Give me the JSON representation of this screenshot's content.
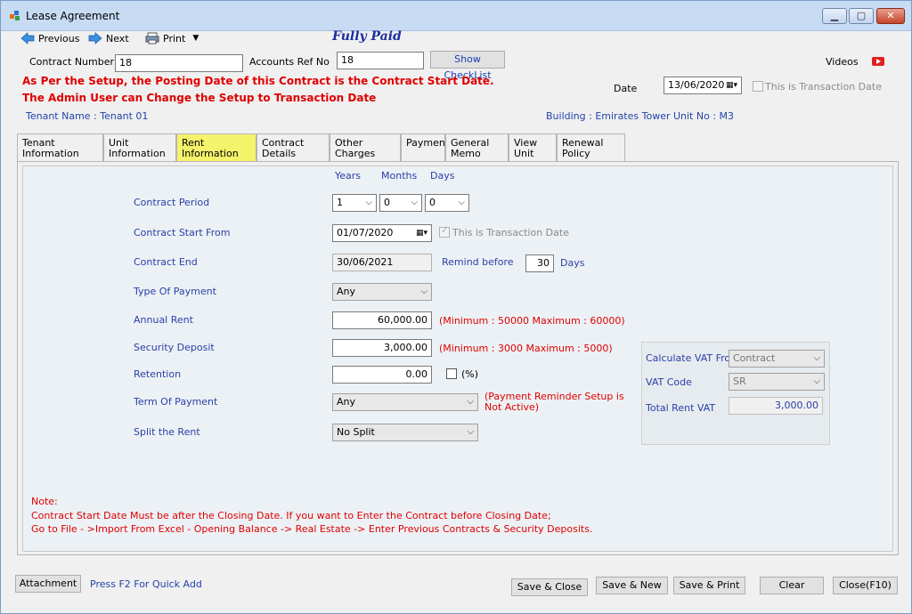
{
  "window": {
    "title": "Lease Agreement"
  },
  "toolbar": {
    "previous": "Previous",
    "next": "Next",
    "print": "Print"
  },
  "status": "Fully Paid",
  "header": {
    "contract_number_label": "Contract Number",
    "contract_number_value": "18",
    "accounts_ref_label": "Accounts Ref No",
    "accounts_ref_value": "18",
    "show_checklist": "Show CheckList",
    "videos": "Videos",
    "warning_line1": "As Per the Setup, the Posting Date of this Contract is the Contract Start Date.",
    "warning_line2": "The Admin User can Change the Setup to Transaction Date",
    "date_label": "Date",
    "date_value": "13/06/2020",
    "transaction_date_label": "This is Transaction Date",
    "tenant_name": "Tenant Name : Tenant 01",
    "building": "Building : Emirates Tower  Unit No : M3"
  },
  "tabs": [
    {
      "label": "Tenant Information"
    },
    {
      "label": "Unit Information"
    },
    {
      "label": "Rent Information"
    },
    {
      "label": "Contract Details"
    },
    {
      "label": "Other Charges"
    },
    {
      "label": "Payment"
    },
    {
      "label": "General Memo"
    },
    {
      "label": "View Unit"
    },
    {
      "label": "Renewal Policy"
    }
  ],
  "rent": {
    "years_header": "Years",
    "months_header": "Months",
    "days_header": "Days",
    "contract_period_label": "Contract Period",
    "period_years": "1",
    "period_months": "0",
    "period_days": "0",
    "contract_start_label": "Contract Start From",
    "contract_start_value": "01/07/2020",
    "start_transaction_label": "This is Transaction Date",
    "contract_end_label": "Contract End",
    "contract_end_value": "30/06/2021",
    "remind_before_label": "Remind before",
    "remind_before_value": "30",
    "days_label": "Days",
    "type_of_payment_label": "Type Of Payment",
    "type_of_payment_value": "Any",
    "annual_rent_label": "Annual Rent",
    "annual_rent_value": "60,000.00",
    "annual_rent_hint": "(Minimum : 50000 Maximum : 60000)",
    "security_deposit_label": "Security Deposit",
    "security_deposit_value": "3,000.00",
    "security_deposit_hint": "(Minimum : 3000 Maximum : 5000)",
    "retention_label": "Retention",
    "retention_value": "0.00",
    "retention_percent_label": "(%)",
    "term_of_payment_label": "Term Of Payment",
    "term_of_payment_value": "Any",
    "term_hint": "(Payment Reminder Setup is Not Active)",
    "split_rent_label": "Split the Rent",
    "split_rent_value": "No Split"
  },
  "vat": {
    "calc_label": "Calculate VAT From",
    "calc_value": "Contract",
    "code_label": "VAT Code",
    "code_value": "SR",
    "total_label": "Total Rent VAT",
    "total_value": "3,000.00"
  },
  "note": {
    "title": "Note:",
    "line1": "Contract Start Date Must be after the Closing Date. If you want to Enter the Contract before Closing Date;",
    "line2": "Go to File - >Import From Excel - Opening Balance -> Real Estate -> Enter Previous Contracts & Security Deposits."
  },
  "footer": {
    "attachment": "Attachment",
    "quick_add_hint": "Press F2 For Quick Add",
    "save_close": "Save & Close",
    "save_new": "Save & New",
    "save_print": "Save & Print",
    "clear": "Clear",
    "close": "Close(F10)"
  },
  "colors": {
    "active_tab": "#f5f26b",
    "warning": "#e00000",
    "label_blue": "#2a3fa8",
    "status": "#1a2fa0"
  }
}
